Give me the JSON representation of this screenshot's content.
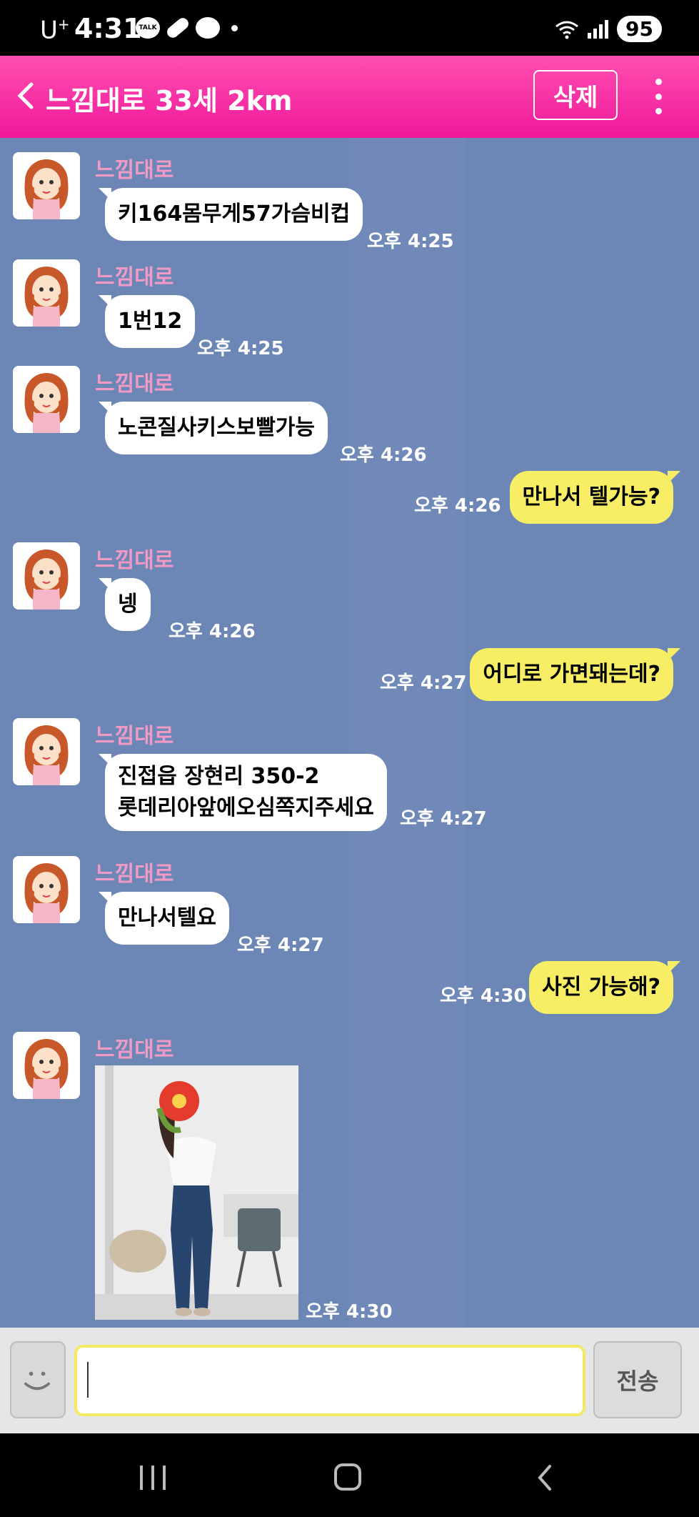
{
  "status_bar": {
    "carrier": "U",
    "carrier_sup": "+",
    "time": "4:31",
    "talk_label": "TALK",
    "battery": "95"
  },
  "header": {
    "title": "느낌대로 33세 2km",
    "delete_label": "삭제"
  },
  "messages": [
    {
      "dir": "in",
      "sender": "느낌대로",
      "text": "키164몸무게57가슴비컵",
      "time": "오후 4:25"
    },
    {
      "dir": "in",
      "sender": "느낌대로",
      "text": "1번12",
      "time": "오후 4:25"
    },
    {
      "dir": "in",
      "sender": "느낌대로",
      "text": "노콘질사키스보빨가능",
      "time": "오후 4:26"
    },
    {
      "dir": "out",
      "text": "만나서  텔가능?",
      "time": "오후 4:26"
    },
    {
      "dir": "in",
      "sender": "느낌대로",
      "text": "넹",
      "time": "오후 4:26"
    },
    {
      "dir": "out",
      "text": "어디로 가면돼는데?",
      "time": "오후 4:27"
    },
    {
      "dir": "in",
      "sender": "느낌대로",
      "line1": "진접읍 장현리 350-2",
      "line2": "롯데리아앞에오심쪽지주세요",
      "time": "오후 4:27"
    },
    {
      "dir": "in",
      "sender": "느낌대로",
      "text": "만나서텔요",
      "time": "오후 4:27"
    },
    {
      "dir": "out",
      "text": "사진 가능해?",
      "time": "오후 4:30"
    },
    {
      "dir": "in",
      "sender": "느낌대로",
      "type": "photo",
      "time": "오후 4:30"
    }
  ],
  "input": {
    "value": "",
    "placeholder": ""
  },
  "send_label": "전송",
  "colors": {
    "header": "#f0189a",
    "chat_bg": "#6c87b5",
    "out_bubble": "#f7ee66",
    "sender": "#f19ac6"
  }
}
